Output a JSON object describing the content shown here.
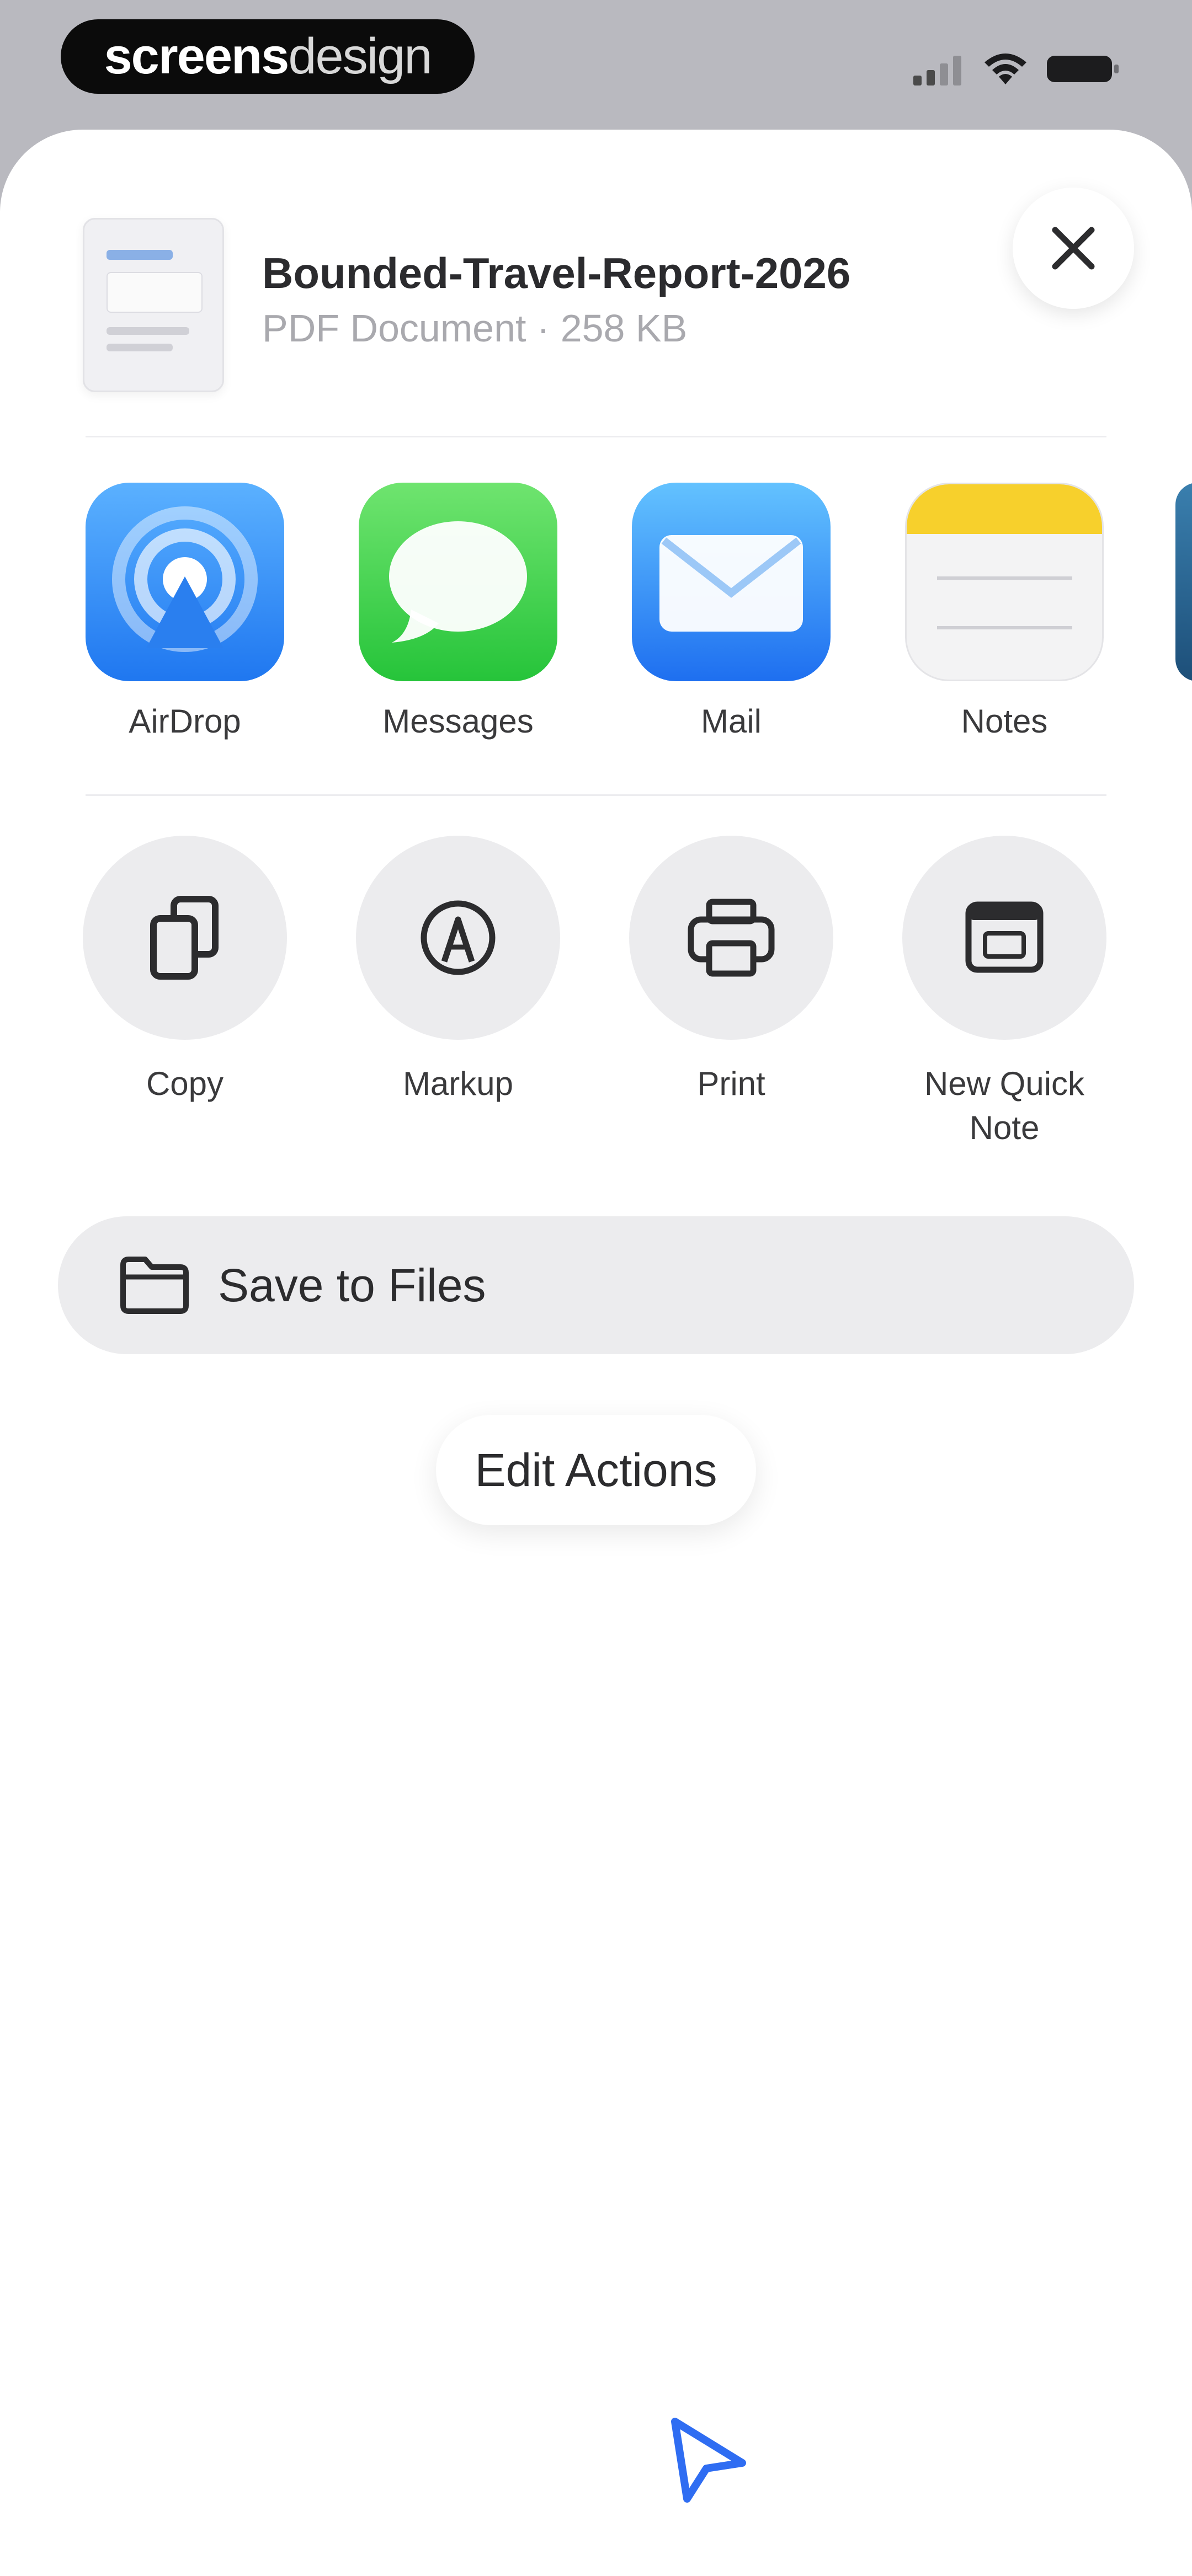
{
  "status_bar": {
    "brand_part1": "screens",
    "brand_part2": "design",
    "icons": [
      "signal-icon",
      "wifi-icon",
      "battery-icon"
    ]
  },
  "share_sheet": {
    "file": {
      "title": "Bounded-Travel-Report-2026",
      "subtitle": "PDF Document · 258 KB"
    },
    "close_icon": "close-icon",
    "apps": [
      {
        "label": "AirDrop",
        "icon": "airdrop-icon"
      },
      {
        "label": "Messages",
        "icon": "messages-icon"
      },
      {
        "label": "Mail",
        "icon": "mail-icon"
      },
      {
        "label": "Notes",
        "icon": "notes-icon"
      }
    ],
    "actions": [
      {
        "label": "Copy",
        "icon": "copy-icon"
      },
      {
        "label": "Markup",
        "icon": "markup-icon"
      },
      {
        "label": "Print",
        "icon": "print-icon"
      },
      {
        "label": "New Quick Note",
        "icon": "quick-note-icon"
      }
    ],
    "save_to_files": {
      "label": "Save to Files",
      "icon": "folder-icon"
    },
    "edit_actions_label": "Edit Actions"
  },
  "colors": {
    "accent": "#1f77f0",
    "messages_green": "#26c43a",
    "notes_yellow": "#f7d02c",
    "sheet_bg": "#ffffff",
    "backdrop": "#b9b9bf"
  },
  "cursor_icon": "pointer-cursor-icon"
}
